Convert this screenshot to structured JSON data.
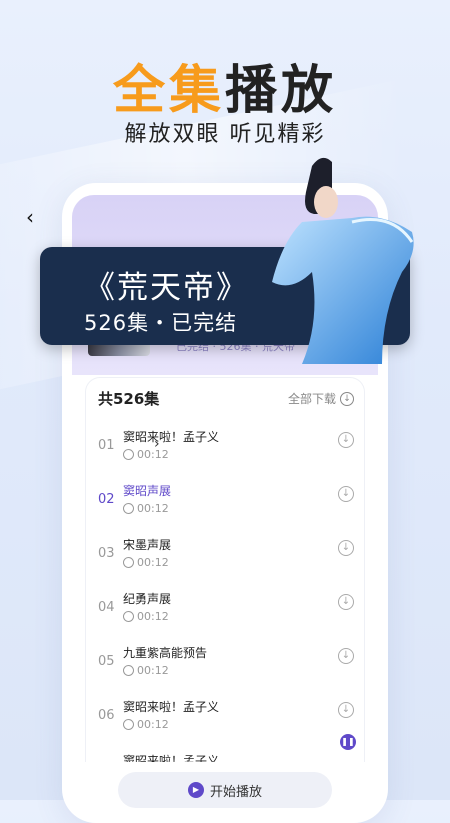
{
  "headline": {
    "accent": "全集",
    "rest": "播放"
  },
  "subhead": "解放双眼 听见精彩",
  "book": {
    "title": "《荒天帝》",
    "subtitle": "526集・已完结",
    "meta": "已完结 · 526集 · 荒天帝"
  },
  "list": {
    "count_label": "共526集",
    "download_all": "全部下载",
    "episodes": [
      {
        "num": "01",
        "title": "窦昭来啦！孟子义",
        "duration": "00:12",
        "active": false
      },
      {
        "num": "02",
        "title": "窦昭声展",
        "duration": "00:12",
        "active": true
      },
      {
        "num": "03",
        "title": "宋墨声展",
        "duration": "00:12",
        "active": false
      },
      {
        "num": "04",
        "title": "纪勇声展",
        "duration": "00:12",
        "active": false
      },
      {
        "num": "05",
        "title": "九重紫高能预告",
        "duration": "00:12",
        "active": false
      },
      {
        "num": "06",
        "title": "窦昭来啦！孟子义",
        "duration": "00:12",
        "active": false
      },
      {
        "num": "",
        "title": "窦昭来啦！孟子义",
        "duration": "",
        "active": false
      }
    ]
  },
  "start_button": "开始播放",
  "icons": {
    "back": "chevron-left-icon",
    "download": "download-icon",
    "clock": "clock-icon",
    "play": "play-icon",
    "pause": "pause-icon"
  },
  "colors": {
    "accent_orange": "#f79b1c",
    "accent_purple": "#5f49c9",
    "promo_bg": "#1a2e4d"
  }
}
